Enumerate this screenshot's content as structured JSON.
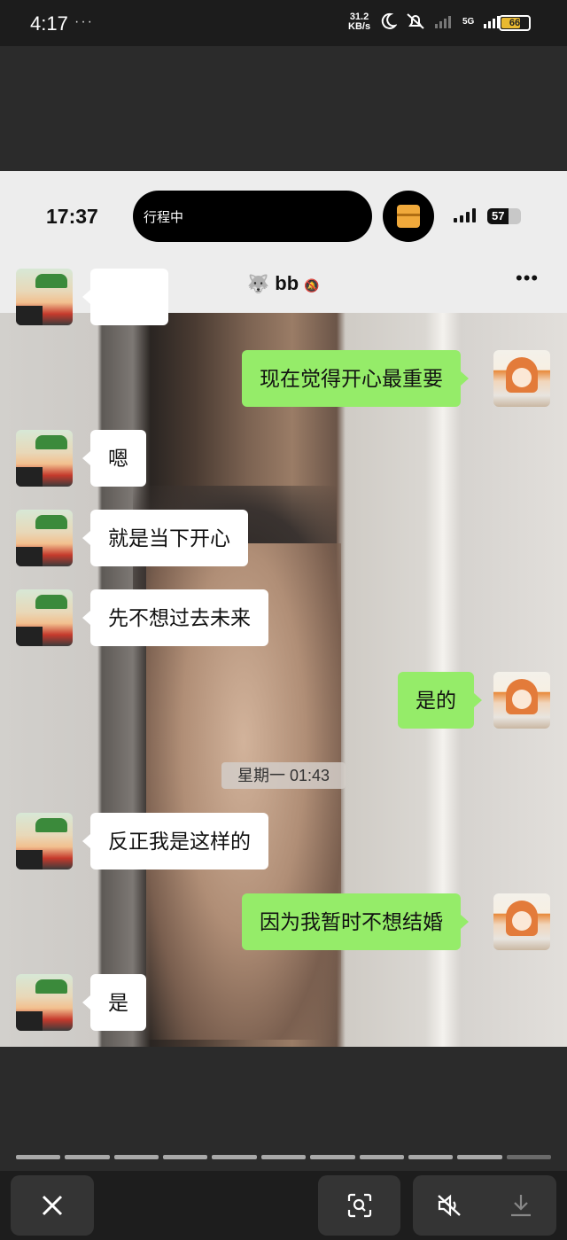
{
  "outer_status": {
    "time": "4:17",
    "dots": "···",
    "net_speed_value": "31.2",
    "net_speed_unit": "KB/s",
    "network": "5G",
    "battery": "66"
  },
  "inner_status": {
    "time": "17:37",
    "island_text": "行程中",
    "battery": "57"
  },
  "chat": {
    "contact_name": "bb",
    "messages": [
      {
        "side": "right",
        "text": "现在觉得开心最重要"
      },
      {
        "side": "left",
        "text": "嗯"
      },
      {
        "side": "left",
        "text": "就是当下开心"
      },
      {
        "side": "left",
        "text": "先不想过去未来"
      },
      {
        "side": "right",
        "text": "是的"
      },
      {
        "side": "left",
        "text": "反正我是这样的"
      },
      {
        "side": "right",
        "text": "因为我暂时不想结婚"
      },
      {
        "side": "left",
        "text": "是"
      }
    ],
    "time_divider": "星期一 01:43"
  },
  "viewer": {
    "progress_segments": 11,
    "current_segment": 11
  },
  "icons": {
    "close": "close-icon",
    "scan": "scan-icon",
    "mute": "mute-icon",
    "download": "download-icon"
  }
}
